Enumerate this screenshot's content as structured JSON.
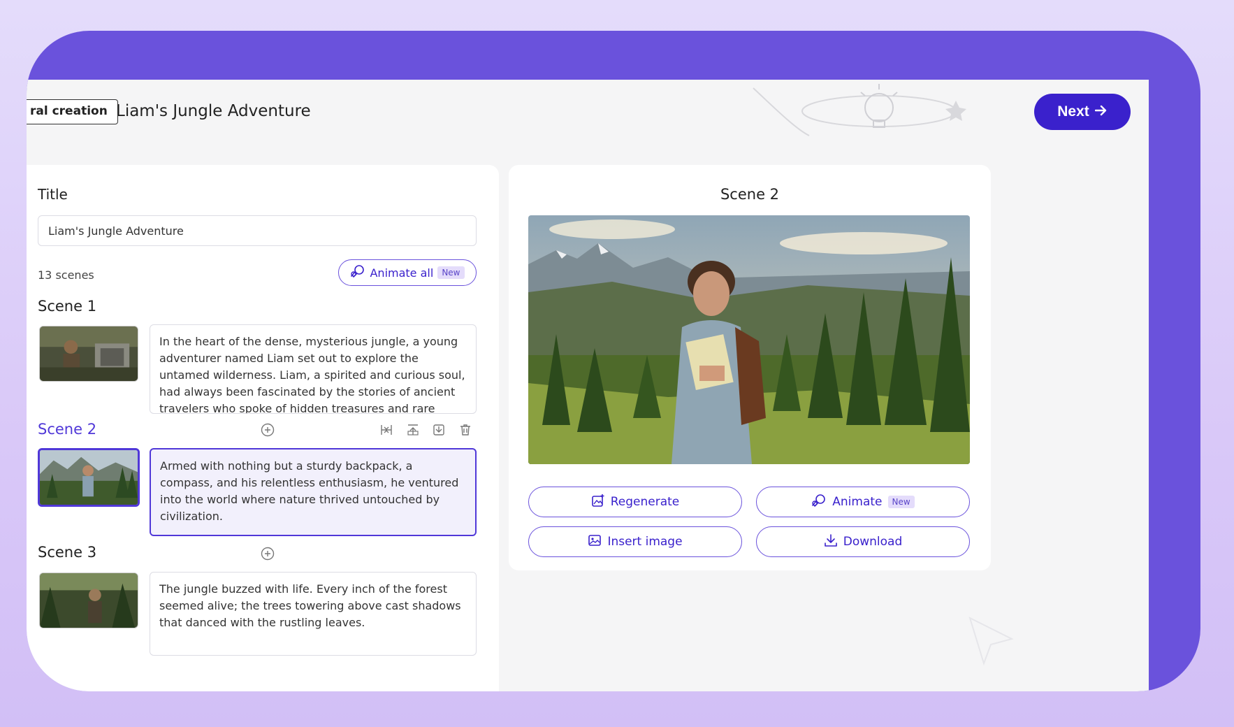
{
  "header": {
    "mode_chip": "ral creation",
    "title": "Liam's Jungle Adventure",
    "next_label": "Next",
    "next_icon": "arrow-right-icon"
  },
  "editor": {
    "title_label": "Title",
    "title_value": "Liam's Jungle Adventure",
    "scene_count": "13 scenes",
    "animate_all_label": "Animate all",
    "animate_all_badge": "New",
    "scenes": [
      {
        "label": "Scene 1",
        "text": "In the heart of the dense, mysterious jungle, a young adventurer named Liam set out to explore the untamed wilderness. Liam, a spirited and curious soul, had always been fascinated by the stories of ancient travelers who spoke of hidden treasures and rare species dwelling deep within the forest."
      },
      {
        "label": "Scene 2",
        "text": "Armed with nothing but a sturdy backpack, a compass, and his relentless enthusiasm, he ventured into the world where nature thrived untouched by civilization."
      },
      {
        "label": "Scene 3",
        "text": "The jungle buzzed with life. Every inch of the forest seemed alive; the trees towering above cast shadows that danced with the rustling leaves."
      }
    ]
  },
  "preview": {
    "title": "Scene 2",
    "regenerate_label": "Regenerate",
    "animate_label": "Animate",
    "animate_badge": "New",
    "insert_image_label": "Insert image",
    "download_label": "Download"
  },
  "colors": {
    "accent": "#3a21cc",
    "frame": "#6a52dc",
    "active_scene": "#5038d8"
  }
}
